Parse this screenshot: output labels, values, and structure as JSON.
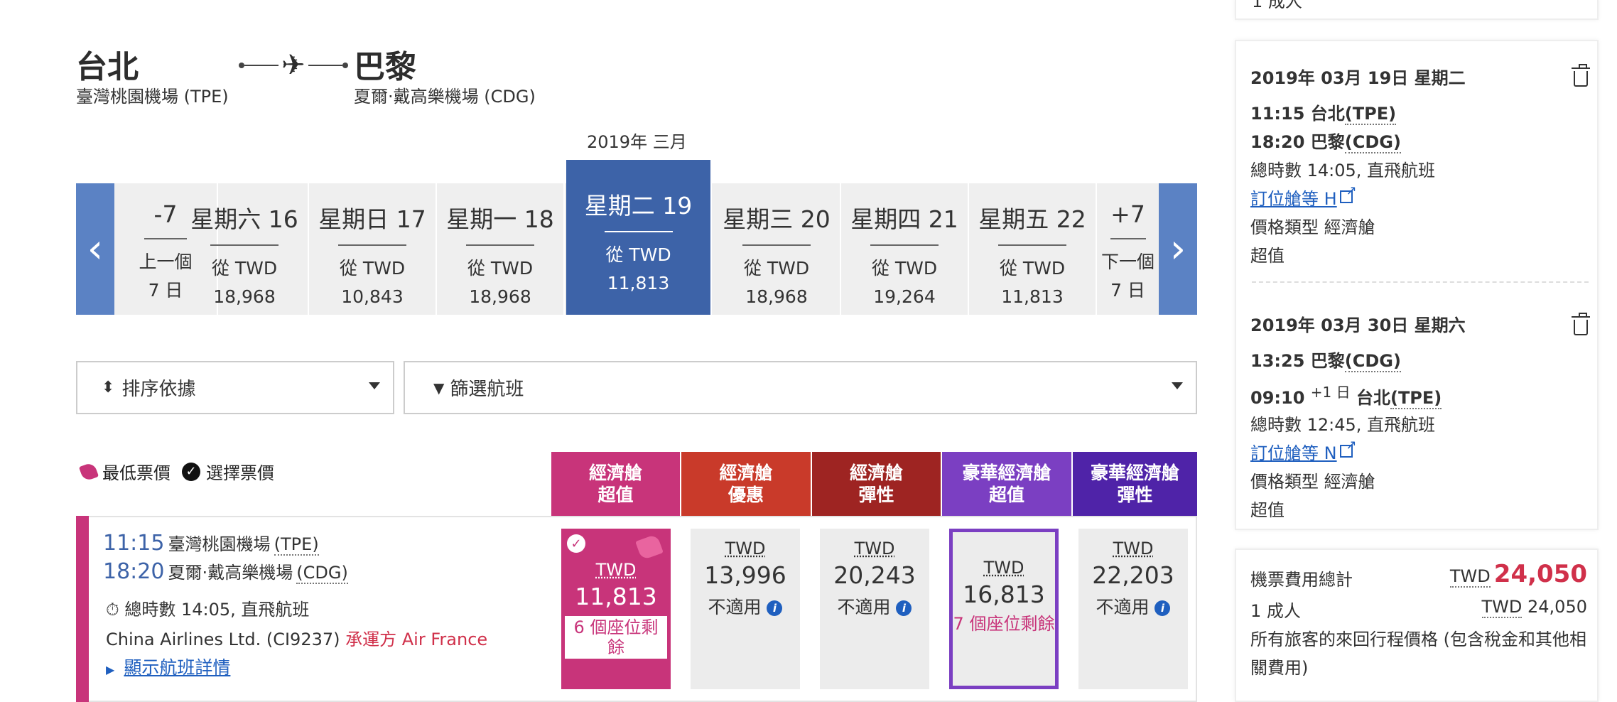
{
  "route": {
    "origin_city": "台北",
    "origin_airport": "臺灣桃園機場 (TPE)",
    "dest_city": "巴黎",
    "dest_airport": "夏爾·戴高樂機場 (CDG)",
    "plane_icon": "✈"
  },
  "calendar": {
    "month_label": "2019年 三月",
    "prev_arrow": "‹",
    "next_arrow": "›",
    "prev": {
      "name": "-7",
      "line1": "上一個",
      "line2": "7 日"
    },
    "next": {
      "name": "+7",
      "line1": "下一個",
      "line2": "7 日"
    },
    "days": [
      {
        "name": "星期六 16",
        "from": "從 TWD",
        "price": "18,968"
      },
      {
        "name": "星期日 17",
        "from": "從 TWD",
        "price": "10,843"
      },
      {
        "name": "星期一 18",
        "from": "從 TWD",
        "price": "18,968"
      },
      {
        "name": "星期二 19",
        "from": "從 TWD",
        "price": "11,813",
        "selected": true
      },
      {
        "name": "星期三 20",
        "from": "從 TWD",
        "price": "18,968"
      },
      {
        "name": "星期四 21",
        "from": "從 TWD",
        "price": "19,264"
      },
      {
        "name": "星期五 22",
        "from": "從 TWD",
        "price": "11,813"
      }
    ]
  },
  "controls": {
    "sort_label": "排序依據",
    "sort_icon": "⬍",
    "filter_label": "篩選航班",
    "filter_icon": "▼"
  },
  "legend": {
    "lowest": "最低票價",
    "selected": "選擇票價"
  },
  "cabins": [
    {
      "line1": "經濟艙",
      "line2": "超值",
      "color": "#c8347a"
    },
    {
      "line1": "經濟艙",
      "line2": "優惠",
      "color": "#c93a2a"
    },
    {
      "line1": "經濟艙",
      "line2": "彈性",
      "color": "#9e2422"
    },
    {
      "line1": "豪華經濟艙",
      "line2": "超值",
      "color": "#7b3fc2"
    },
    {
      "line1": "豪華經濟艙",
      "line2": "彈性",
      "color": "#4f23a8"
    }
  ],
  "flight": {
    "dep_time": "11:15",
    "dep_place": "臺灣桃園機場",
    "dep_code": "(TPE)",
    "arr_time": "18:20",
    "arr_place": "夏爾·戴高樂機場",
    "arr_code": "(CDG)",
    "duration": "總時數 14:05, 直飛航班",
    "carrier": "China Airlines Ltd. (CI9237)",
    "operated": "承運方 Air France",
    "details_link": "顯示航班詳情"
  },
  "fares": [
    {
      "currency": "TWD",
      "amount": "11,813",
      "seats": "6 個座位剩餘"
    },
    {
      "currency": "TWD",
      "amount": "13,996",
      "note": "不適用"
    },
    {
      "currency": "TWD",
      "amount": "20,243",
      "note": "不適用"
    },
    {
      "currency": "TWD",
      "amount": "16,813",
      "seats": "7 個座位剩餘"
    },
    {
      "currency": "TWD",
      "amount": "22,203",
      "note": "不適用"
    }
  ],
  "summary": {
    "top_cutoff": "1 成人",
    "outbound": {
      "date": "2019年 03月 19日 星期二",
      "dep": "11:15 台北(TPE)",
      "dep_time": "11:15",
      "dep_city": "台北",
      "dep_code": "(TPE)",
      "arr_time": "18:20",
      "arr_city": "巴黎",
      "arr_code": "(CDG)",
      "duration": "總時數 14:05, 直飛航班",
      "booking_class": "訂位艙等 H",
      "fare_type": "價格類型 經濟艙",
      "fare_name": "超值"
    },
    "inbound": {
      "date": "2019年 03月 30日 星期六",
      "dep_time": "13:25",
      "dep_city": "巴黎",
      "dep_code": "(CDG)",
      "arr_time": "09:10",
      "arr_plus": "+1 日",
      "arr_city": "台北",
      "arr_code": "(TPE)",
      "duration": "總時數 12:45, 直飛航班",
      "booking_class": "訂位艙等 N",
      "fare_type": "價格類型 經濟艙",
      "fare_name": "超值"
    },
    "total": {
      "label": "機票費用總計",
      "currency": "TWD",
      "amount": "24,050",
      "pax_label": "1 成人",
      "pax_currency": "TWD",
      "pax_amount": "24,050",
      "note": "所有旅客的來回行程價格 (包含稅金和其他相關費用)"
    }
  }
}
